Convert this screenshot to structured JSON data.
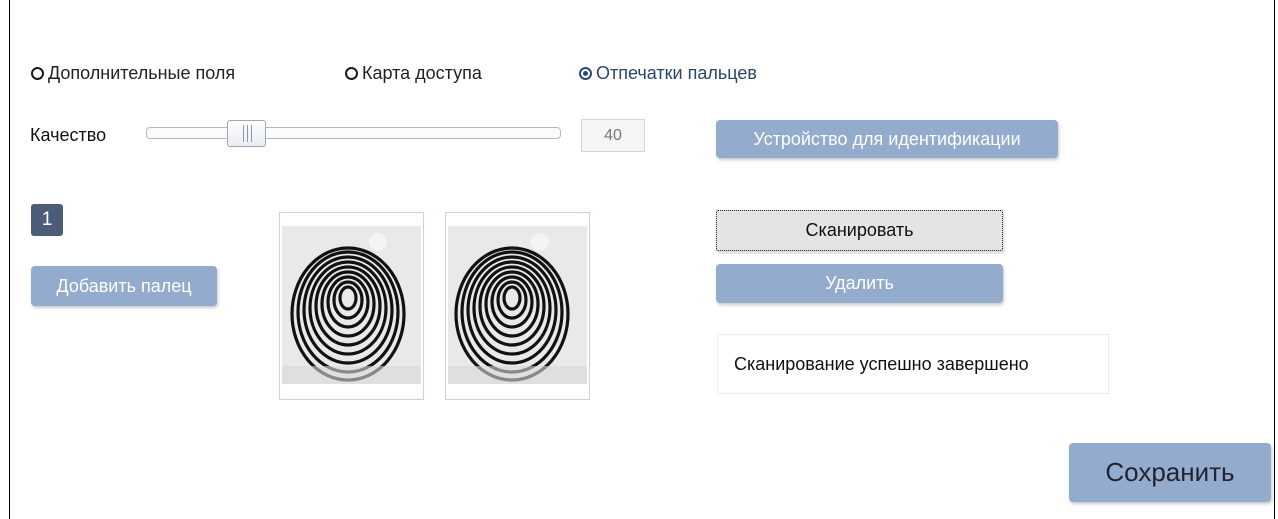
{
  "tabs": {
    "additional_fields": "Дополнительные поля",
    "access_card": "Карта доступа",
    "fingerprints": "Отпечатки пальцев",
    "selected": "fingerprints"
  },
  "quality": {
    "label": "Качество",
    "value": "40",
    "slider_fraction": 0.24
  },
  "buttons": {
    "device": "Устройство для идентификации",
    "add_finger": "Добавить палец",
    "scan": "Сканировать",
    "delete": "Удалить",
    "save": "Сохранить"
  },
  "fingers": {
    "selected_number": "1"
  },
  "status": {
    "message": "Сканирование успешно завершено"
  },
  "colors": {
    "button_blue": "#93abcc",
    "badge": "#4c5d7a",
    "selected_radio": "#2b4a7a"
  }
}
